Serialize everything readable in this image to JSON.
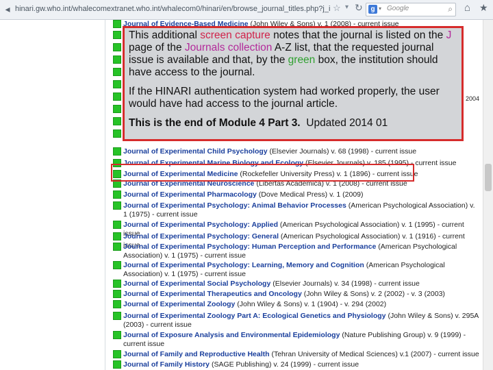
{
  "browser": {
    "url": "hinari.gw.who.int/whalecomextranet.who.int/whalecom0/hinari/en/browse_journal_titles.php?j_init=J",
    "search_engine_label": "Google"
  },
  "overlay": {
    "para1": {
      "part1": "This additional ",
      "hl1": "screen capture",
      "part2": " notes that the journal is listed on the ",
      "hl2": "J",
      "part3": " page of the ",
      "hl3": "Journals collection",
      "part4": " A-Z list, that the requested journal issue is available and that, by the ",
      "hl4": "green",
      "part5": " box, the institution should have access to the journal."
    },
    "para2": "If the HINARI authentication system had worked properly, the user would have had access to the journal article.",
    "end_bold": "This is the end of Module 4 Part 3.",
    "updated": "Updated 2014 01"
  },
  "journals": [
    {
      "title": "Journal of Evidence-Based Medicine",
      "rest": " (John Wiley & Sons) v. 1 (2008) - current issue"
    },
    {
      "title": "Journal of Experimental Child Psychology",
      "rest": " (Elsevier Journals) v. 68 (1998) - current issue"
    },
    {
      "title": "Journal of Experimental Marine Biology and Ecology",
      "rest": " (Elsevier Journals) v. 185 (1995) - current issue"
    },
    {
      "title": "Journal of Experimental Medicine",
      "rest": " (Rockefeller University Press) v. 1 (1896) - current issue"
    },
    {
      "title": "Journal of Experimental Neuroscience",
      "rest": " (Libertas Academica) v. 1 (2008) - current issue"
    },
    {
      "title": "Journal of Experimental Pharmacology",
      "rest": " (Dove Medical Press) v. 1 (2009)"
    },
    {
      "title": "Journal of Experimental Psychology: Animal Behavior Processes",
      "rest": " (American Psychological Association) v. 1 (1975) - current issue"
    },
    {
      "title": "Journal of Experimental Psychology: Applied",
      "rest": " (American Psychological Association) v. 1 (1995) - current issue"
    },
    {
      "title": "Journal of Experimental Psychology: General",
      "rest": " (American Psychological Association) v. 1 (1916) - current issue"
    },
    {
      "title": "Journal of Experimental Psychology: Human Perception and Performance",
      "rest": " (American Psychological Association) v. 1 (1975) - current issue"
    },
    {
      "title": "Journal of Experimental Psychology: Learning, Memory and Cognition",
      "rest": " (American Psychological Association) v. 1 (1975) - current issue"
    },
    {
      "title": "Journal of Experimental Social Psychology",
      "rest": " (Elsevier Journals) v. 34 (1998) - current issue"
    },
    {
      "title": "Journal of Experimental Therapeutics and Oncology",
      "rest": " (John Wiley & Sons) v. 2 (2002) - v. 3 (2003)"
    },
    {
      "title": "Journal of Experimental Zoology",
      "rest": " (John Wiley & Sons) v. 1 (1904) - v. 294 (2002)"
    },
    {
      "title": "Journal of Experimental Zoology Part A: Ecological Genetics and Physiology",
      "rest": " (John Wiley & Sons) v. 295A (2003) - current issue"
    },
    {
      "title": "Journal of Exposure Analysis and Environmental Epidemiology",
      "rest": " (Nature Publishing Group) v. 9 (1999) - current issue"
    },
    {
      "title": "Journal of Family and Reproductive Health",
      "rest": " (Tehran University of Medical Sciences) v.1 (2007) - current issue"
    },
    {
      "title": "Journal of Family History",
      "rest": " (SAGE Publishing) v. 24 (1999) - current issue"
    }
  ],
  "partial_right_text": "2004"
}
